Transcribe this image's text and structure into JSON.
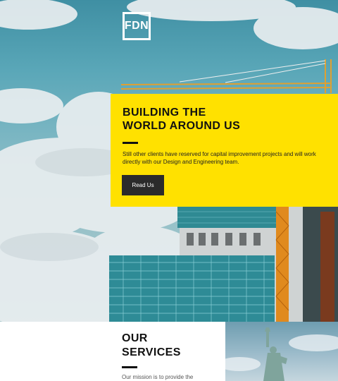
{
  "brand": {
    "logo_text": "FDN"
  },
  "hero": {
    "title_line1": "BUILDING THE",
    "title_line2": "WORLD AROUND US",
    "description": "Still other clients have reserved for capital improvement projects and will work directly with our Design and Engineering team.",
    "button_label": "Read Us"
  },
  "services": {
    "title_line1": "OUR",
    "title_line2": "SERVICES",
    "intro": "Our mission is to provide the"
  },
  "colors": {
    "accent": "#ffe100",
    "button": "#2b2b2b",
    "sky": "#5aa7b8"
  }
}
